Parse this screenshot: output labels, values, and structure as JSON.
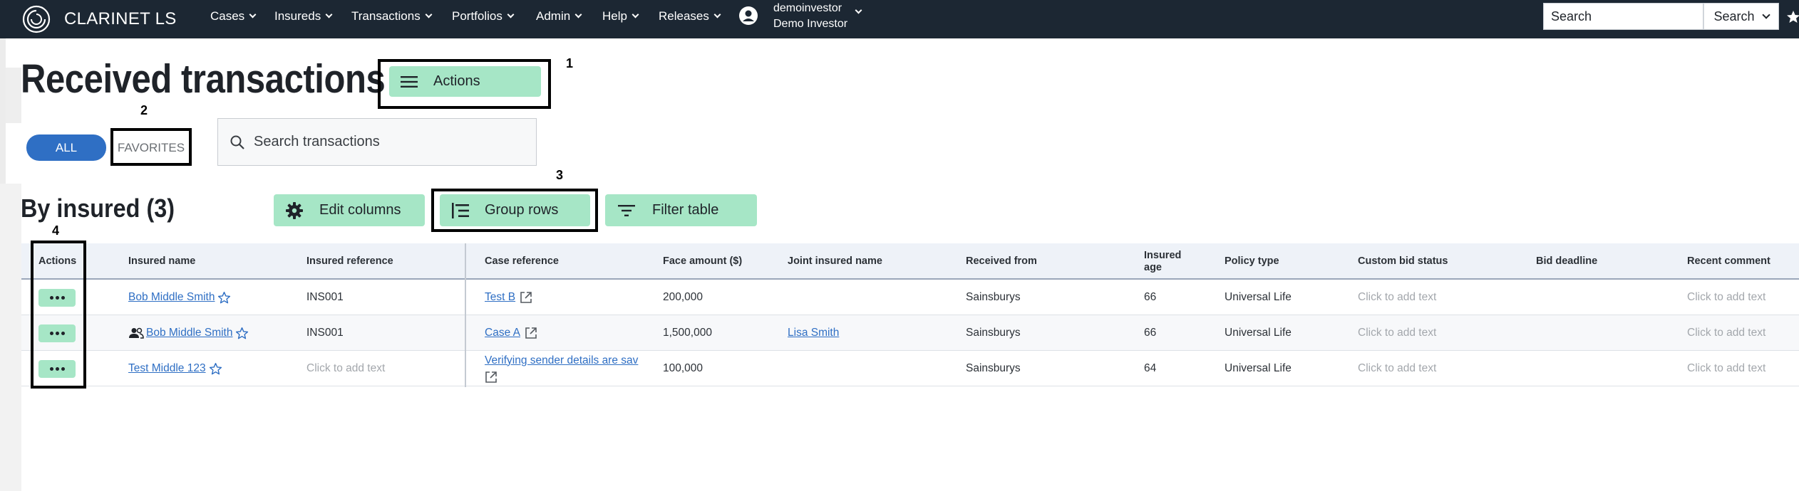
{
  "nav": {
    "brand": "CLARINET LS",
    "menus": [
      {
        "label": "Cases",
        "name": "nav-menu-cases"
      },
      {
        "label": "Insureds",
        "name": "nav-menu-insureds"
      },
      {
        "label": "Transactions",
        "name": "nav-menu-transactions"
      },
      {
        "label": "Portfolios",
        "name": "nav-menu-portfolios"
      },
      {
        "label": "Admin",
        "name": "nav-menu-admin"
      },
      {
        "label": "Help",
        "name": "nav-menu-help"
      },
      {
        "label": "Releases",
        "name": "nav-menu-releases"
      }
    ],
    "username": "demoinvestor",
    "display_name": "Demo Investor",
    "search_placeholder": "Search",
    "search_button": "Search"
  },
  "header": {
    "title": "Received transactions",
    "actions_label": "Actions"
  },
  "filters": {
    "all_label": "ALL",
    "favorites_label": "FAVORITES",
    "search_placeholder": "Search transactions"
  },
  "section": {
    "title": "By insured (3)",
    "edit_columns": "Edit columns",
    "group_rows": "Group rows",
    "filter_table": "Filter table"
  },
  "markers": [
    "1",
    "2",
    "3",
    "4"
  ],
  "table": {
    "columns": {
      "actions": "Actions",
      "insured_name": "Insured name",
      "insured_reference": "Insured reference",
      "case_reference": "Case reference",
      "face_amount": "Face amount ($)",
      "joint_insured_name": "Joint insured name",
      "received_from": "Received from",
      "insured_age": "Insured age",
      "policy_type": "Policy type",
      "custom_bid_status": "Custom bid status",
      "bid_deadline": "Bid deadline",
      "recent_comment": "Recent comment"
    },
    "rows": [
      {
        "insured_name": "Bob Middle Smith",
        "insured_reference": "INS001",
        "case_reference": "Test B",
        "face_amount": "200,000",
        "joint_insured_name": "",
        "received_from": "Sainsburys",
        "insured_age": "66",
        "policy_type": "Universal Life",
        "custom_bid_status": "Click to add text",
        "bid_deadline": "",
        "recent_comment": "Click to add text"
      },
      {
        "insured_name": "Bob Middle Smith",
        "insured_reference": "INS001",
        "case_reference": "Case A",
        "face_amount": "1,500,000",
        "joint_insured_name": "Lisa Smith",
        "received_from": "Sainsburys",
        "insured_age": "66",
        "policy_type": "Universal Life",
        "custom_bid_status": "Click to add text",
        "bid_deadline": "",
        "recent_comment": "Click to add text"
      },
      {
        "insured_name": "Test Middle 123",
        "insured_reference": "Click to add text",
        "case_reference": "Verifying sender details are sav",
        "face_amount": "100,000",
        "joint_insured_name": "",
        "received_from": "Sainsburys",
        "insured_age": "64",
        "policy_type": "Universal Life",
        "custom_bid_status": "Click to add text",
        "bid_deadline": "",
        "recent_comment": "Click to add text"
      }
    ]
  },
  "colors": {
    "navbar_bg": "#1c2733",
    "accent_green": "#a6e6c6",
    "chip_blue": "#2f6fc4",
    "link_blue": "#2f6fc4"
  }
}
